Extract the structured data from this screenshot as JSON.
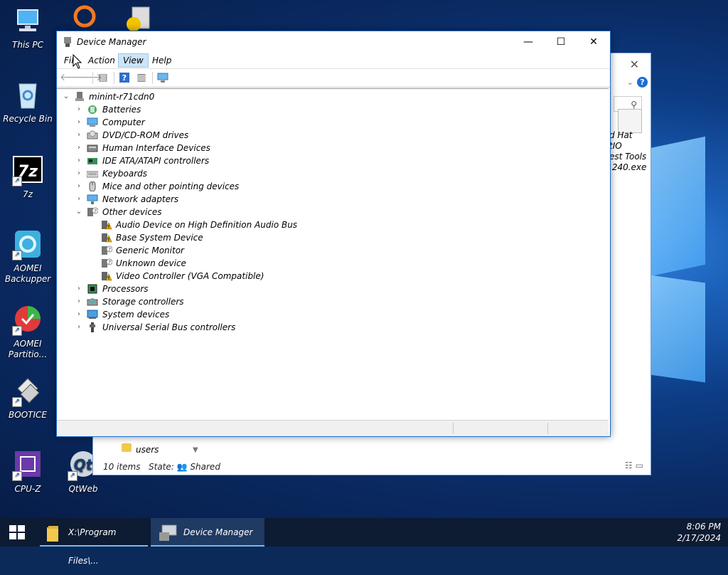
{
  "desktop": {
    "icons": [
      {
        "label": "This PC"
      },
      {
        "label": "Recycle Bin"
      },
      {
        "label": "7z"
      },
      {
        "label": "AOMEI Backupper"
      },
      {
        "label": "AOMEI Partitio..."
      },
      {
        "label": "BOOTICE"
      },
      {
        "label": "CPU-Z"
      },
      {
        "label": "QtWeb"
      }
    ]
  },
  "explorer": {
    "file_label": "d Hat\ntIO\nest Tools\n.240.exe",
    "folder_label": "users",
    "status_items": "10 items",
    "status_state": "State:",
    "status_shared": "Shared"
  },
  "device_manager": {
    "title": "Device Manager",
    "menu": [
      "File",
      "Action",
      "View",
      "Help"
    ],
    "active_menu": "View",
    "tree": {
      "root": "minint-r71cdn0",
      "categories": [
        {
          "label": "Batteries",
          "icon": "battery-icon",
          "expanded": false
        },
        {
          "label": "Computer",
          "icon": "computer-icon",
          "expanded": false
        },
        {
          "label": "DVD/CD-ROM drives",
          "icon": "dvd-drive-icon",
          "expanded": false
        },
        {
          "label": "Human Interface Devices",
          "icon": "hid-icon",
          "expanded": false
        },
        {
          "label": "IDE ATA/ATAPI controllers",
          "icon": "ide-controller-icon",
          "expanded": false
        },
        {
          "label": "Keyboards",
          "icon": "keyboard-icon",
          "expanded": false
        },
        {
          "label": "Mice and other pointing devices",
          "icon": "mouse-icon",
          "expanded": false
        },
        {
          "label": "Network adapters",
          "icon": "network-adapter-icon",
          "expanded": false
        },
        {
          "label": "Other devices",
          "icon": "unknown-device-icon",
          "expanded": true,
          "children": [
            {
              "label": "Audio Device on High Definition Audio Bus",
              "icon": "warning-device-icon"
            },
            {
              "label": "Base System Device",
              "icon": "warning-device-icon"
            },
            {
              "label": "Generic Monitor",
              "icon": "unknown-device-icon"
            },
            {
              "label": "Unknown device",
              "icon": "unknown-device-icon"
            },
            {
              "label": "Video Controller (VGA Compatible)",
              "icon": "warning-device-icon"
            }
          ]
        },
        {
          "label": "Processors",
          "icon": "processor-icon",
          "expanded": false
        },
        {
          "label": "Storage controllers",
          "icon": "storage-controller-icon",
          "expanded": false
        },
        {
          "label": "System devices",
          "icon": "system-device-icon",
          "expanded": false
        },
        {
          "label": "Universal Serial Bus controllers",
          "icon": "usb-icon",
          "expanded": false
        }
      ]
    }
  },
  "taskbar": {
    "items": [
      {
        "label": "X:\\Program Files\\...",
        "icon": "folder-icon",
        "active": false
      },
      {
        "label": "Device Manager",
        "icon": "device-manager-icon",
        "active": true
      }
    ],
    "time": "8:06 PM",
    "date": "2/17/2024"
  },
  "colors": {
    "accent": "#1a6fd1",
    "menu_highlight": "#cce4f7",
    "taskbar": "#0d1b33",
    "warning": "#f2b600"
  }
}
